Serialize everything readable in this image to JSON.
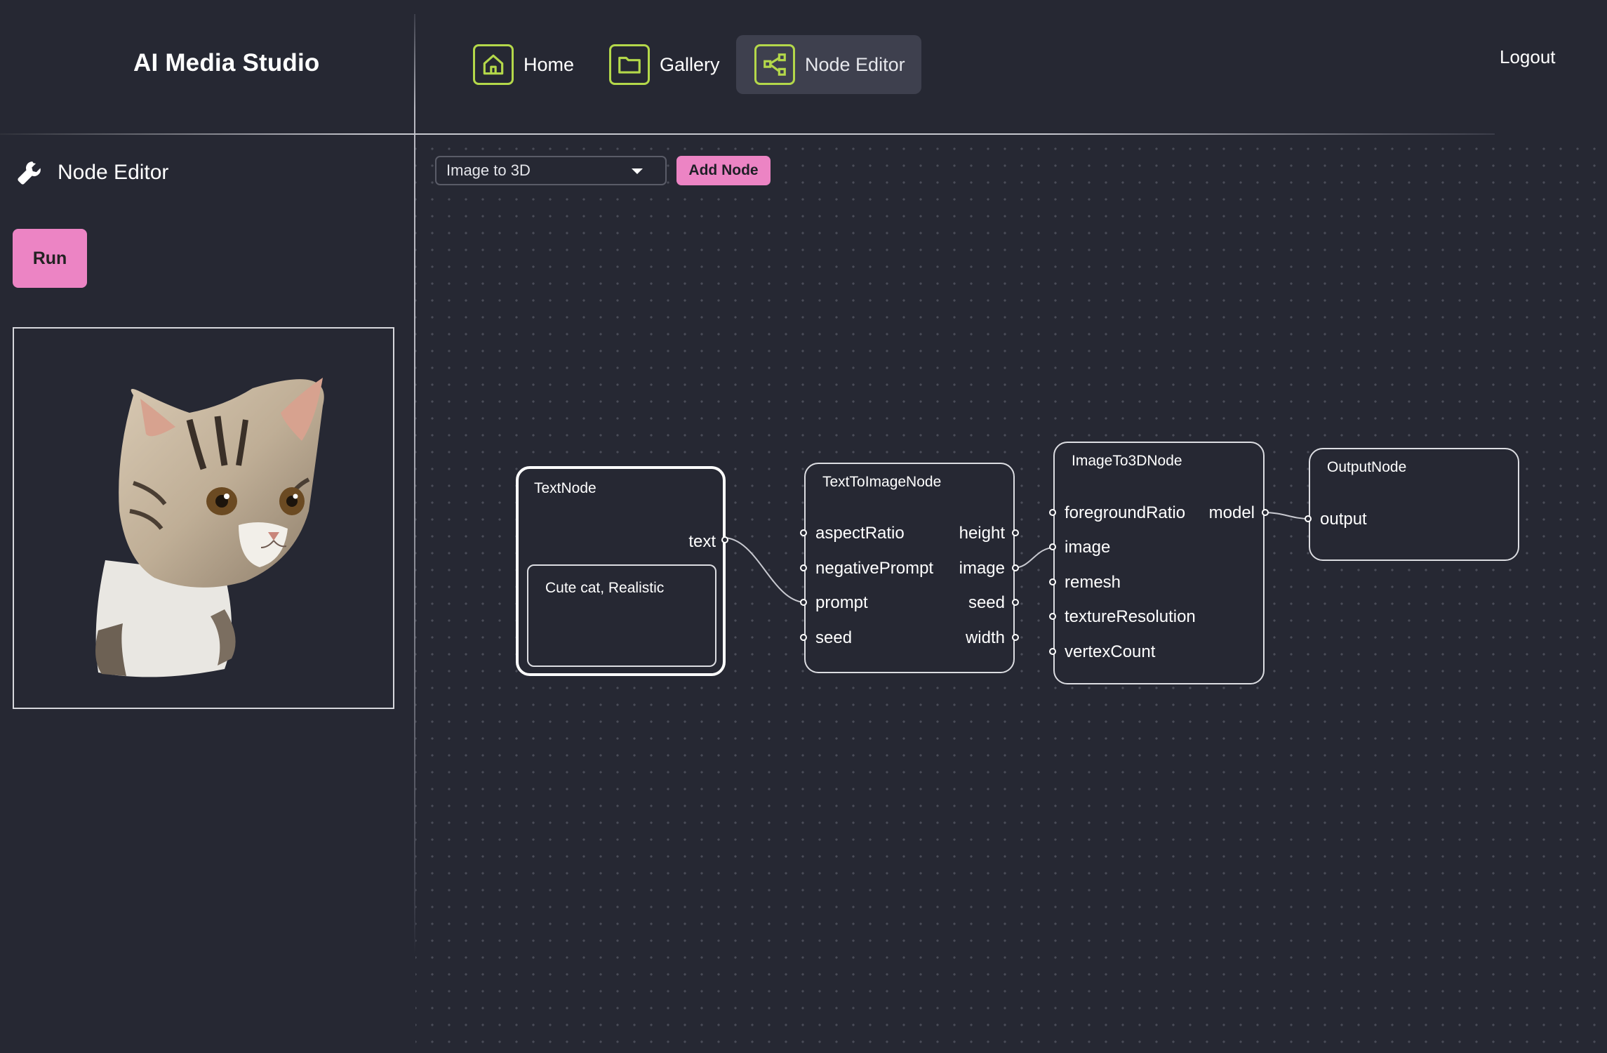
{
  "app": {
    "brand": "AI Media Studio"
  },
  "nav": {
    "home": "Home",
    "gallery": "Gallery",
    "node_editor": "Node Editor",
    "logout": "Logout",
    "accent": "#b4d84a"
  },
  "sidebar": {
    "title": "Node Editor",
    "run_label": "Run",
    "preview_icon": "cat-image"
  },
  "toolbar": {
    "node_type_value": "Image to 3D",
    "add_node_label": "Add Node",
    "button_color": "#ec84c4"
  },
  "nodes": {
    "text": {
      "title": "TextNode",
      "output": "text",
      "value": "Cute cat, Realistic"
    },
    "t2i": {
      "title": "TextToImageNode",
      "inputs": [
        "aspectRatio",
        "negativePrompt",
        "prompt",
        "seed"
      ],
      "outputs": [
        "height",
        "image",
        "seed",
        "width"
      ]
    },
    "i23d": {
      "title": "ImageTo3DNode",
      "inputs": [
        "foregroundRatio",
        "image",
        "remesh",
        "textureResolution",
        "vertexCount"
      ],
      "outputs": [
        "model"
      ]
    },
    "output": {
      "title": "OutputNode",
      "inputs": [
        "output"
      ]
    }
  }
}
